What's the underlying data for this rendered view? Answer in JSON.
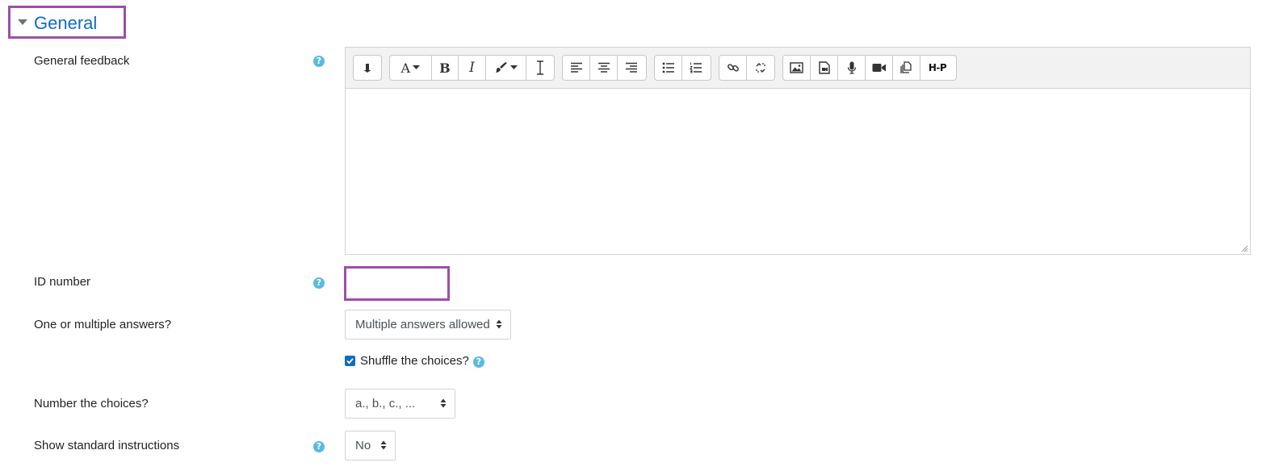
{
  "section": {
    "title": "General"
  },
  "fields": {
    "general_feedback": {
      "label": "General feedback",
      "help": "?"
    },
    "id_number": {
      "label": "ID number",
      "help": "?",
      "value": ""
    },
    "single": {
      "label": "One or multiple answers?",
      "value": "Multiple answers allowed"
    },
    "shuffle": {
      "label": "Shuffle the choices?",
      "checked": true,
      "help": "?"
    },
    "numbering": {
      "label": "Number the choices?",
      "value": "a., b., c., ..."
    },
    "instructions": {
      "label": "Show standard instructions",
      "help": "?",
      "value": "No"
    }
  },
  "toolbar": {
    "groups": [
      [
        "collapse-icon"
      ],
      [
        "font-style-icon",
        "bold-icon",
        "italic-icon",
        "text-color-icon",
        "clear-format-icon"
      ],
      [
        "align-left-icon",
        "align-center-icon",
        "align-right-icon"
      ],
      [
        "unordered-list-icon",
        "ordered-list-icon"
      ],
      [
        "link-icon",
        "unlink-icon"
      ],
      [
        "image-icon",
        "media-icon",
        "record-audio-icon",
        "record-video-icon",
        "manage-files-icon",
        "h5p-icon"
      ]
    ],
    "h5p_label": "H-P"
  },
  "colors": {
    "accent": "#9c4fa8",
    "link": "#0f6cbf",
    "help": "#5bb9e3",
    "checkbox": "#0f6cbf"
  }
}
